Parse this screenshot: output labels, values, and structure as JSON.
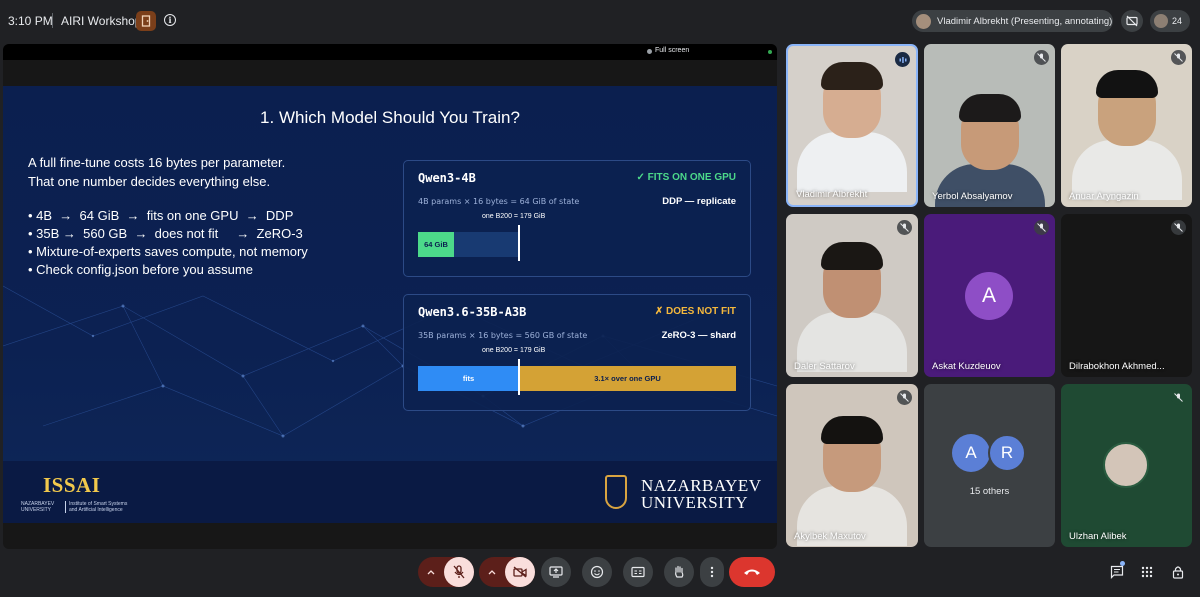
{
  "meeting": {
    "time": "3:10 PM",
    "title": "AIRI Workshop",
    "presenter_chip": "Vladimir Albrekht (Presenting, annotating)",
    "participant_count": "24"
  },
  "stage": {
    "fullscreen_label": "Full screen"
  },
  "slide": {
    "title": "1. Which Model Should You Train?",
    "intro_lines": [
      "A full fine-tune costs 16 bytes per parameter.",
      "That one number decides everything else."
    ],
    "bullets": [
      "• 4B  →  64 GiB  →  fits on one GPU  →  DDP",
      "• 35B →  560 GB  →  does not fit     →  ZeRO-3",
      "• Mixture-of-experts saves compute, not memory",
      "• Check config.json before you assume"
    ],
    "cards": [
      {
        "model": "Qwen3-4B",
        "status": "✓  FITS ON ONE GPU",
        "params": "4B params × 16 bytes  =  64 GiB of state",
        "strategy": "DDP  —  replicate",
        "b200": "one B200 = 179 GiB",
        "bar_label": "64 GiB",
        "bar_fraction": 0.36,
        "status_color": "#4cd98a"
      },
      {
        "model": "Qwen3.6-35B-A3B",
        "status": "✗  DOES NOT FIT",
        "params": "35B params × 16 bytes  =  560 GB of state",
        "strategy": "ZeRO-3  —  shard",
        "b200": "one B200 = 179 GiB",
        "bar_fits_label": "fits",
        "bar_over_label": "3.1× over one GPU",
        "status_color": "#f5b83d"
      }
    ],
    "footer": {
      "issai_logo": "ISSAI",
      "issai_sub_left": "NAZARBAYEV UNIVERSITY",
      "issai_sub_right": "Institute of Smart Systems and Artificial Intelligence",
      "nu_line1": "NAZARBAYEV",
      "nu_line2": "UNIVERSITY"
    }
  },
  "participants": [
    {
      "name": "Vladimir Albrekht",
      "speaking": true
    },
    {
      "name": "Yerbol Absalyamov",
      "speaking": false
    },
    {
      "name": "Anuar Aryngazin",
      "speaking": false
    },
    {
      "name": "Daler Sattarov",
      "speaking": false
    },
    {
      "name": "Askat Kuzdeuov",
      "initial": "A",
      "speaking": false
    },
    {
      "name": "Dilrabokhon Akhmed...",
      "speaking": false
    },
    {
      "name": "Akylbek Maxutov",
      "speaking": false
    },
    {
      "name": "15 others",
      "initials": [
        "A",
        "R"
      ]
    },
    {
      "name": "Ulzhan Alibek",
      "speaking": false
    }
  ],
  "colors": {
    "accent_blue": "#8ab4f8",
    "end_call_red": "#dc362e",
    "mic_off_bg": "#f9dedc",
    "bar_blue": "#2f8cf5",
    "bar_gold": "#d4a235",
    "bar_green": "#4cd98a"
  }
}
